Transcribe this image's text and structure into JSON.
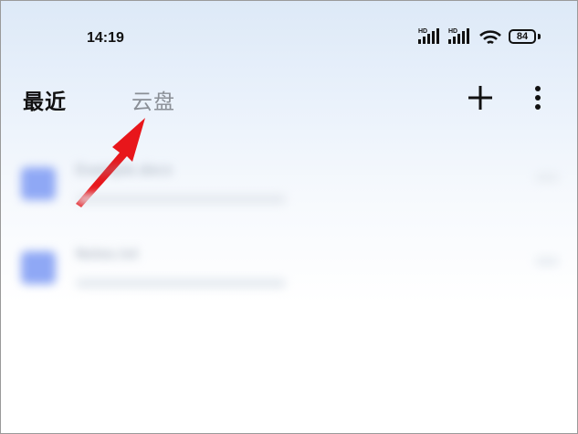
{
  "status_bar": {
    "time": "14:19",
    "signal_1_label": "HD",
    "signal_2_label": "HD",
    "wifi_label": "6",
    "battery": "84"
  },
  "header": {
    "tab_recent": "最近",
    "tab_cloud": "云盘",
    "add_icon": "plus-icon",
    "more_icon": "more-vertical-icon"
  },
  "annotation": {
    "arrow_color": "#e8161b"
  },
  "files": [
    {
      "name": "Example.docx"
    },
    {
      "name": "Notes.txt"
    }
  ]
}
